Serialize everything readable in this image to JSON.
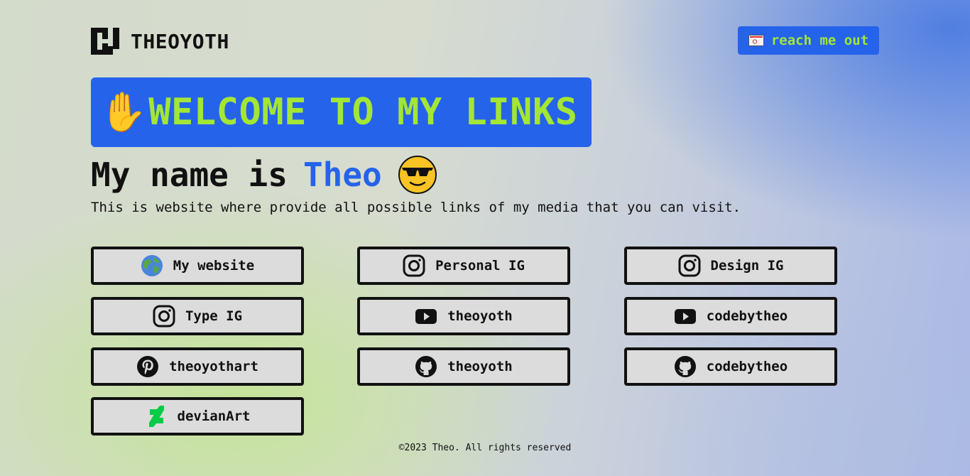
{
  "header": {
    "brand": "THEOYOTH",
    "logo_icon": "theoyoth-logo-icon",
    "reach_button": {
      "label": "reach me out",
      "icon": "envelope-icon"
    }
  },
  "hero": {
    "banner_text": "WELCOME TO MY LINKS",
    "banner_icon": "waving-hand-icon",
    "name_prefix": "My name is",
    "name_highlight": "Theo",
    "name_icon": "sunglasses-face-icon",
    "subtitle": "This is website where provide all possible links of my media that you can visit."
  },
  "links": [
    {
      "label": "My website",
      "icon": "globe-icon"
    },
    {
      "label": "Personal IG",
      "icon": "instagram-icon"
    },
    {
      "label": "Design IG",
      "icon": "instagram-icon"
    },
    {
      "label": "Type IG",
      "icon": "instagram-icon"
    },
    {
      "label": "theoyoth",
      "icon": "youtube-icon"
    },
    {
      "label": "codebytheo",
      "icon": "youtube-icon"
    },
    {
      "label": "theoyothart",
      "icon": "pinterest-icon"
    },
    {
      "label": "theoyoth",
      "icon": "github-icon"
    },
    {
      "label": "codebytheo",
      "icon": "github-icon"
    },
    {
      "label": "devianArt",
      "icon": "deviantart-icon"
    }
  ],
  "footer": {
    "text": "©2023 Theo. All rights reserved"
  },
  "colors": {
    "accent_blue": "#2563eb",
    "accent_green": "#a3e635",
    "button_bg": "#dcdcdc",
    "border": "#111111"
  }
}
